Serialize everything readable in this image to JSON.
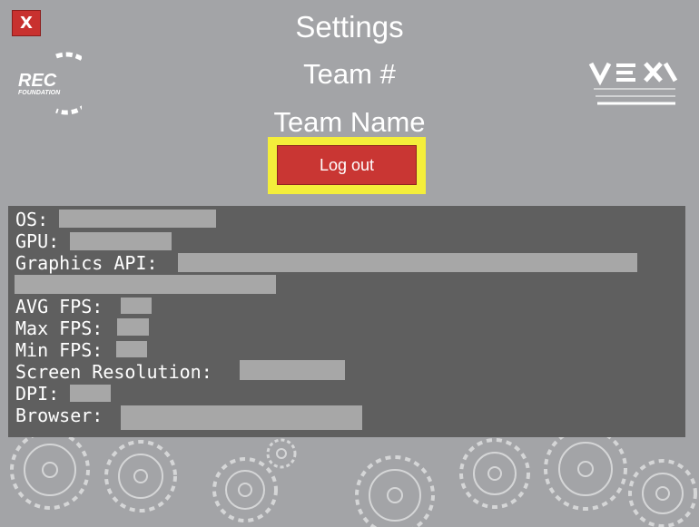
{
  "header": {
    "close_label": "X",
    "title": "Settings",
    "team_number_label": "Team #",
    "team_name_label": "Team Name",
    "logout_label": "Log out",
    "left_logo_text": "REC FOUNDATION",
    "right_logo_text": "VEX ROBOTICS COMPETITION"
  },
  "stats": {
    "os_label": "OS:",
    "gpu_label": "GPU:",
    "graphics_api_label": "Graphics API:",
    "avg_fps_label": "AVG FPS:",
    "max_fps_label": "Max FPS:",
    "min_fps_label": "Min FPS:",
    "screen_resolution_label": "Screen Resolution:",
    "dpi_label": "DPI:",
    "browser_label": "Browser:"
  },
  "colors": {
    "background": "#a3a4a7",
    "panel": "#5f5f5f",
    "button_red": "#c93633",
    "highlight_yellow": "#f4ee3b",
    "text": "#ffffff",
    "redaction": "#a7a7a7"
  },
  "icons": {
    "close": "close-icon",
    "background": "gear-icon"
  }
}
